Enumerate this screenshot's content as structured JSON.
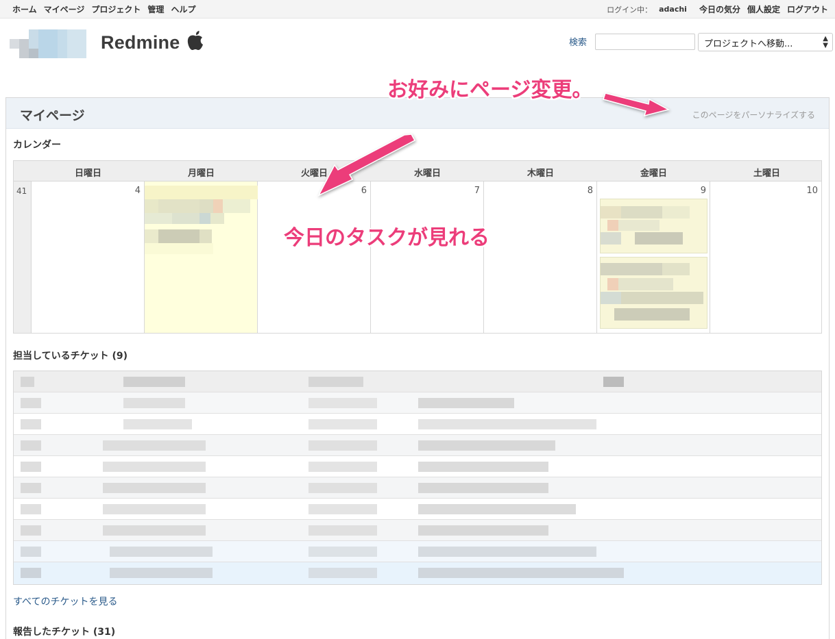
{
  "top_menu": {
    "left": [
      "ホーム",
      "マイページ",
      "プロジェクト",
      "管理",
      "ヘルプ"
    ],
    "logged_in_as": "ログイン中：",
    "user": "adachi",
    "right": [
      "今日の気分",
      "個人設定",
      "ログアウト"
    ]
  },
  "header": {
    "site_title": "Redmine",
    "search_label": "検索",
    "search_value": "",
    "project_jump": "プロジェクトへ移動..."
  },
  "page": {
    "title": "マイページ",
    "personalize_link": "このページをパーソナライズする"
  },
  "calendar": {
    "heading": "カレンダー",
    "days_of_week": [
      "日曜日",
      "月曜日",
      "火曜日",
      "水曜日",
      "木曜日",
      "金曜日",
      "土曜日"
    ],
    "week_number": "41",
    "dates": [
      "4",
      "",
      "6",
      "7",
      "8",
      "9",
      "10"
    ]
  },
  "tickets_assigned": {
    "heading": "担当しているチケット (9)",
    "view_all": "すべてのチケットを見る"
  },
  "tickets_reported": {
    "heading": "報告したチケット (31)"
  },
  "annotations": {
    "personalize_note": "お好みにページ変更。",
    "today_note": "今日のタスクが見れる"
  },
  "colors": {
    "annotation": "#ec3d7a",
    "link": "#2a5a8a",
    "today_bg": "#ffffdd",
    "title_bar_bg": "#edf2f7"
  }
}
